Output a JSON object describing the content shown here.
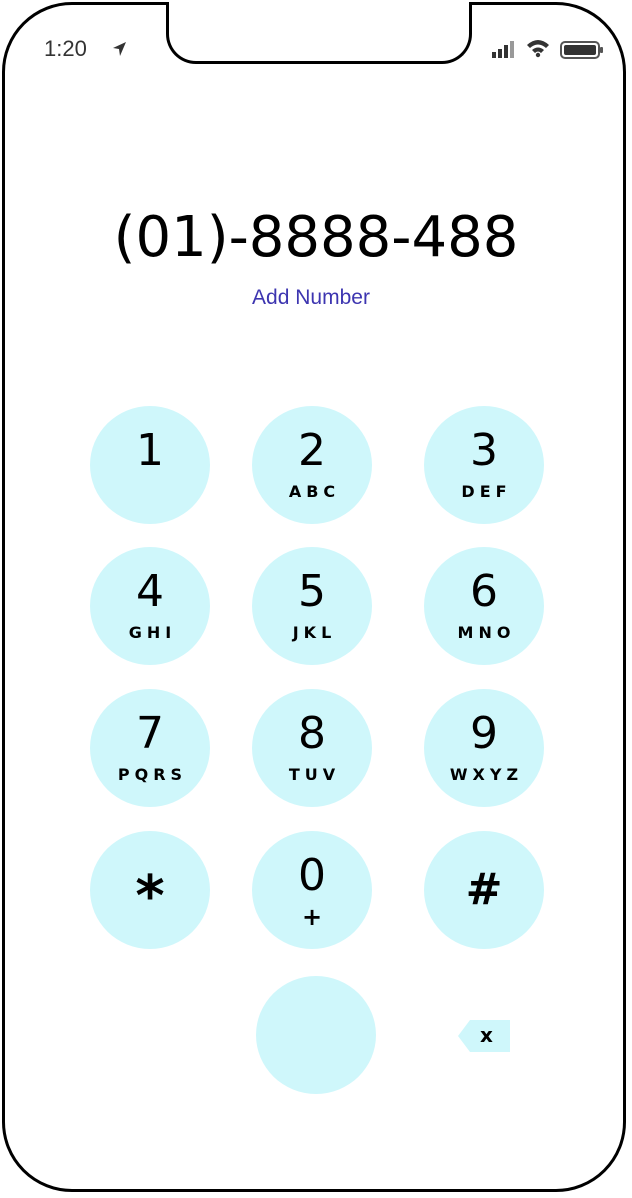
{
  "status_bar": {
    "time": "1:20",
    "icons": [
      "location-arrow-icon",
      "cellular-signal-icon",
      "wifi-icon",
      "battery-icon"
    ]
  },
  "dialer": {
    "number": "(01)-8888-488",
    "add_number_label": "Add Number",
    "keys": [
      {
        "digit": "1",
        "letters": ""
      },
      {
        "digit": "2",
        "letters": "ABC"
      },
      {
        "digit": "3",
        "letters": "DEF"
      },
      {
        "digit": "4",
        "letters": "GHI"
      },
      {
        "digit": "5",
        "letters": "JKL"
      },
      {
        "digit": "6",
        "letters": "MNO"
      },
      {
        "digit": "7",
        "letters": "PQRS"
      },
      {
        "digit": "8",
        "letters": "TUV"
      },
      {
        "digit": "9",
        "letters": "WXYZ"
      },
      {
        "digit": "*",
        "letters": ""
      },
      {
        "digit": "0",
        "letters": "+"
      },
      {
        "digit": "#",
        "letters": ""
      }
    ],
    "backspace_label": "x"
  },
  "colors": {
    "key_background": "#cff7fb",
    "link": "#3d35b0",
    "frame": "#000000"
  }
}
